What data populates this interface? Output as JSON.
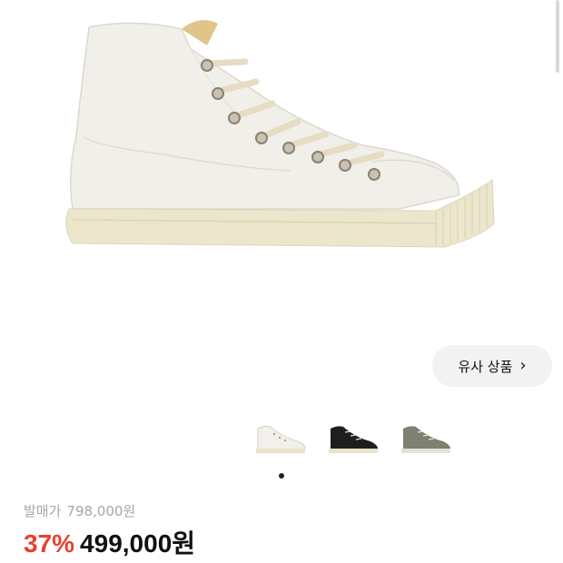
{
  "product_image": {
    "alt": "white high-top canvas sneaker",
    "shoe_colors": {
      "canvas": "#f1efe9",
      "sole": "#ebe6cc",
      "laces": "#e6dcc4",
      "lining": "#e0c48a"
    }
  },
  "similar_button": {
    "label": "유사 상품",
    "icon": "chevron-right-icon"
  },
  "thumbnails": [
    {
      "name": "white",
      "color": "#f2f0ea",
      "sole": "#e9e3c9",
      "selected": true
    },
    {
      "name": "black",
      "color": "#1e1e1e",
      "sole": "#e9e3c9",
      "selected": false
    },
    {
      "name": "olive",
      "color": "#7c8170",
      "sole": "#e6e2d6",
      "selected": false
    }
  ],
  "pagination": {
    "current": 1,
    "total": 1
  },
  "price": {
    "original_label": "발매가",
    "original_value": "798,000원",
    "discount": "37%",
    "sale": "499,000원"
  },
  "colors": {
    "discount": "#e8412c",
    "muted_text": "#a6a6a6",
    "button_bg": "#f2f2f2"
  }
}
